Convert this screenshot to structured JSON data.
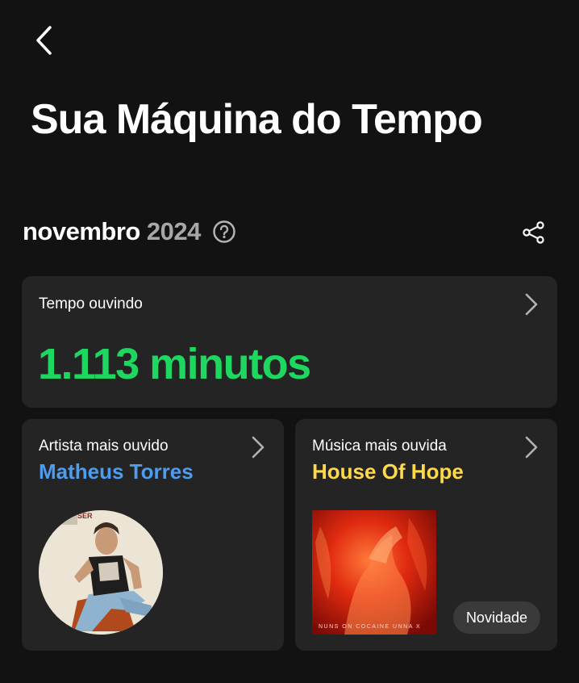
{
  "header": {
    "title": "Sua Máquina do Tempo",
    "back_icon": "chevron-left-icon"
  },
  "period": {
    "month": "novembro",
    "year": "2024",
    "help_icon": "question-circle-icon",
    "share_icon": "share-icon"
  },
  "listening_time": {
    "label": "Tempo ouvindo",
    "value": "1.113 minutos",
    "color": "#1ed760"
  },
  "top_artist": {
    "label": "Artista mais ouvido",
    "name": "Matheus Torres",
    "color": "#4c9df0"
  },
  "top_song": {
    "label": "Música mais ouvida",
    "name": "House Of Hope",
    "color": "#ffd94a",
    "album_caption": "NUNS ON COCAINE  UNNA X",
    "badge": "Novidade"
  }
}
